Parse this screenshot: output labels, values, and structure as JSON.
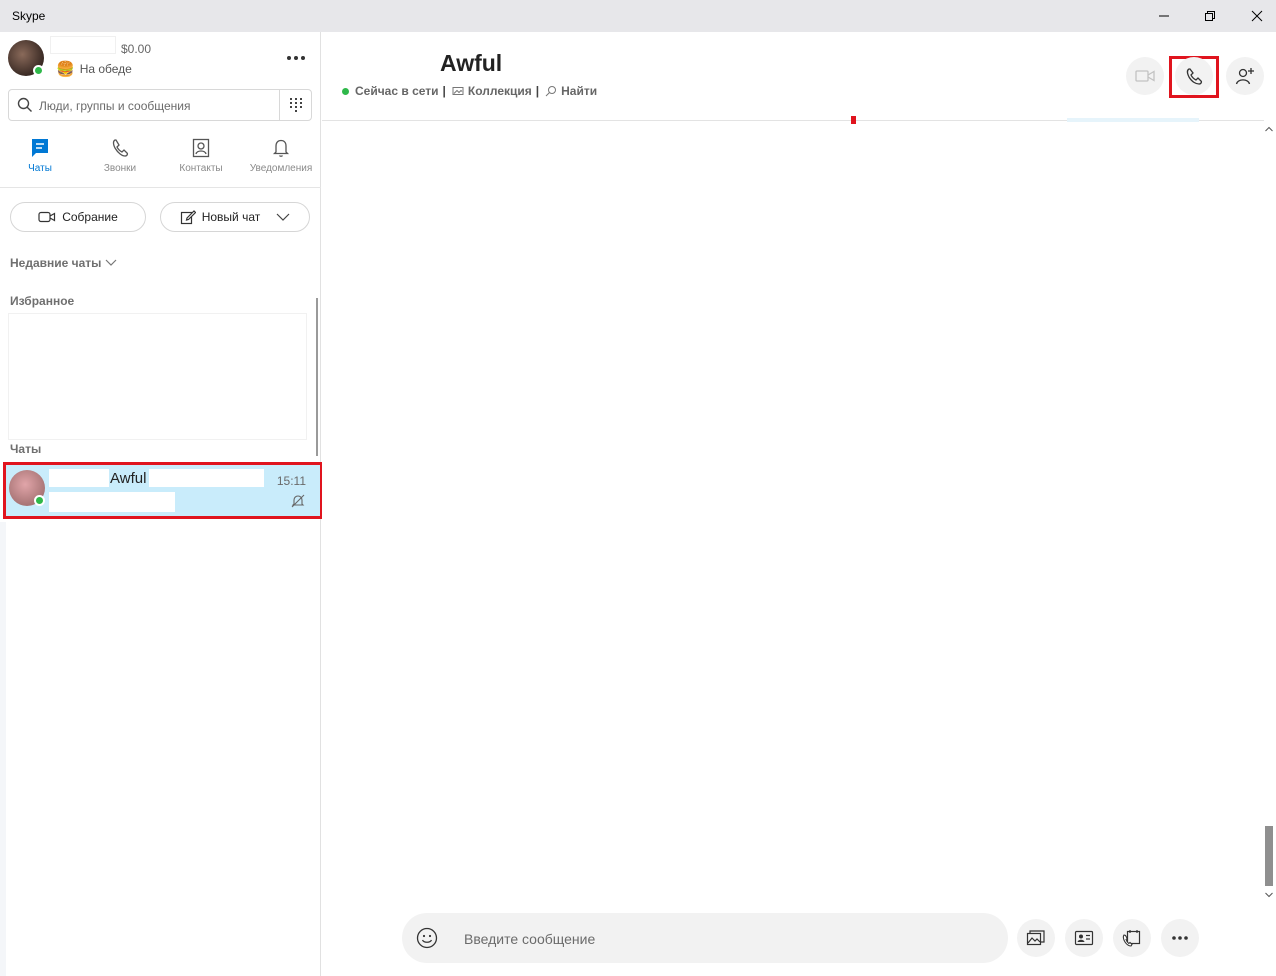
{
  "window": {
    "title": "Skype"
  },
  "profile": {
    "balance": "$0.00",
    "mood_emoji": "🍔",
    "mood": "На обеде"
  },
  "search": {
    "placeholder": "Люди, группы и сообщения"
  },
  "nav": [
    {
      "label": "Чаты",
      "icon": "chat-icon",
      "active": true
    },
    {
      "label": "Звонки",
      "icon": "phone-icon"
    },
    {
      "label": "Контакты",
      "icon": "contacts-icon"
    },
    {
      "label": "Уведомления",
      "icon": "bell-icon"
    }
  ],
  "actions": {
    "meeting": "Собрание",
    "new_chat": "Новый чат"
  },
  "sections": {
    "recent": "Недавние чаты",
    "favorites": "Избранное",
    "chats": "Чаты"
  },
  "chat_list": [
    {
      "name": "Awful",
      "time": "15:11",
      "muted": true
    }
  ],
  "conversation": {
    "title": "Awful",
    "status": "Сейчас в сети",
    "gallery": "Коллекция",
    "find": "Найти",
    "composer_placeholder": "Введите сообщение"
  },
  "colors": {
    "accent": "#0078d4",
    "presence": "#2fb84a",
    "highlight": "#e0141e",
    "selected_row": "#c9ecfb"
  }
}
